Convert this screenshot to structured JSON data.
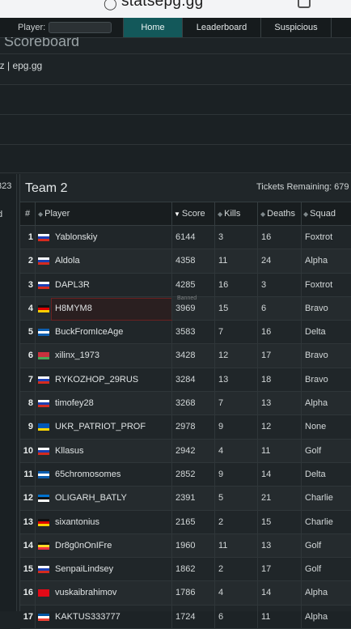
{
  "browser": {
    "url": "statsepg.gg"
  },
  "nav": {
    "player_label": "Player:",
    "player_value": "",
    "items": [
      "Home",
      "Leaderboard",
      "Suspicious"
    ]
  },
  "page": {
    "title": "e Scoreboard",
    "subtitle": "hz | epg.gg"
  },
  "team1": {
    "score_fragment": "323",
    "header_fragment": "d"
  },
  "team2": {
    "name": "Team 2",
    "tickets": "Tickets Remaining: 679",
    "columns": [
      "#",
      "Player",
      "Score",
      "Kills",
      "Deaths",
      "Squad"
    ],
    "sorted_column": "Score",
    "rows": [
      {
        "rank": "1",
        "flag": "ru",
        "player": "Yablonskiy",
        "score": "6144",
        "kills": "3",
        "deaths": "16",
        "squad": "Foxtrot"
      },
      {
        "rank": "2",
        "flag": "ru",
        "player": "Aldola",
        "score": "4358",
        "kills": "11",
        "deaths": "24",
        "squad": "Alpha"
      },
      {
        "rank": "3",
        "flag": "ru",
        "player": "DAPL3R",
        "score": "4285",
        "kills": "16",
        "deaths": "3",
        "squad": "Foxtrot"
      },
      {
        "rank": "4",
        "flag": "de",
        "player": "H8MYM8",
        "score": "3969",
        "kills": "15",
        "deaths": "6",
        "squad": "Bravo",
        "banned": "Banned"
      },
      {
        "rank": "5",
        "flag": "gr",
        "player": "BuckFromIceAge",
        "score": "3583",
        "kills": "7",
        "deaths": "16",
        "squad": "Delta"
      },
      {
        "rank": "6",
        "flag": "by",
        "player": "xilinx_1973",
        "score": "3428",
        "kills": "12",
        "deaths": "17",
        "squad": "Bravo"
      },
      {
        "rank": "7",
        "flag": "ru",
        "player": "RYKOZHOP_29RUS",
        "score": "3284",
        "kills": "13",
        "deaths": "18",
        "squad": "Bravo"
      },
      {
        "rank": "8",
        "flag": "ru",
        "player": "timofey28",
        "score": "3268",
        "kills": "7",
        "deaths": "13",
        "squad": "Alpha"
      },
      {
        "rank": "9",
        "flag": "ua",
        "player": "UKR_PATRIOT_PROF",
        "score": "2978",
        "kills": "9",
        "deaths": "12",
        "squad": "None"
      },
      {
        "rank": "10",
        "flag": "ru",
        "player": "Kllasus",
        "score": "2942",
        "kills": "4",
        "deaths": "11",
        "squad": "Golf"
      },
      {
        "rank": "11",
        "flag": "gr",
        "player": "65chromosomes",
        "score": "2852",
        "kills": "9",
        "deaths": "14",
        "squad": "Delta"
      },
      {
        "rank": "12",
        "flag": "ee",
        "player": "OLIGARH_BATLY",
        "score": "2391",
        "kills": "5",
        "deaths": "21",
        "squad": "Charlie"
      },
      {
        "rank": "13",
        "flag": "de",
        "player": "sixantonius",
        "score": "2165",
        "kills": "2",
        "deaths": "15",
        "squad": "Charlie"
      },
      {
        "rank": "14",
        "flag": "be",
        "player": "Dr8g0nOnIFre",
        "score": "1960",
        "kills": "11",
        "deaths": "13",
        "squad": "Golf"
      },
      {
        "rank": "15",
        "flag": "ru",
        "player": "SenpaiLindsey",
        "score": "1862",
        "kills": "2",
        "deaths": "17",
        "squad": "Golf"
      },
      {
        "rank": "16",
        "flag": "tr",
        "player": "vuskaibrahimov",
        "score": "1786",
        "kills": "4",
        "deaths": "14",
        "squad": "Alpha"
      },
      {
        "rank": "17",
        "flag": "fr",
        "player": "KAKTUS333777",
        "score": "1724",
        "kills": "6",
        "deaths": "11",
        "squad": "Alpha"
      }
    ]
  },
  "flags": {
    "ru": [
      "#ffffff",
      "#1c3fb3",
      "#d52b1e"
    ],
    "de": [
      "#111111",
      "#dd0000",
      "#ffce00"
    ],
    "gr": [
      "#0d5eaf",
      "#ffffff",
      "#0d5eaf"
    ],
    "by": [
      "#c8313e",
      "#c8313e",
      "#4aa657"
    ],
    "ua": [
      "#0057b7",
      "#0057b7",
      "#ffd700"
    ],
    "ee": [
      "#0072ce",
      "#111111",
      "#ffffff"
    ],
    "be": [
      "#111111",
      "#fdda24",
      "#ef3340"
    ],
    "tr": [
      "#e30a17",
      "#e30a17",
      "#e30a17"
    ],
    "fr": [
      "#0055a4",
      "#ffffff",
      "#ef4135"
    ]
  },
  "colors": {
    "accent": "#13585a",
    "banned_border": "#6b2020"
  }
}
